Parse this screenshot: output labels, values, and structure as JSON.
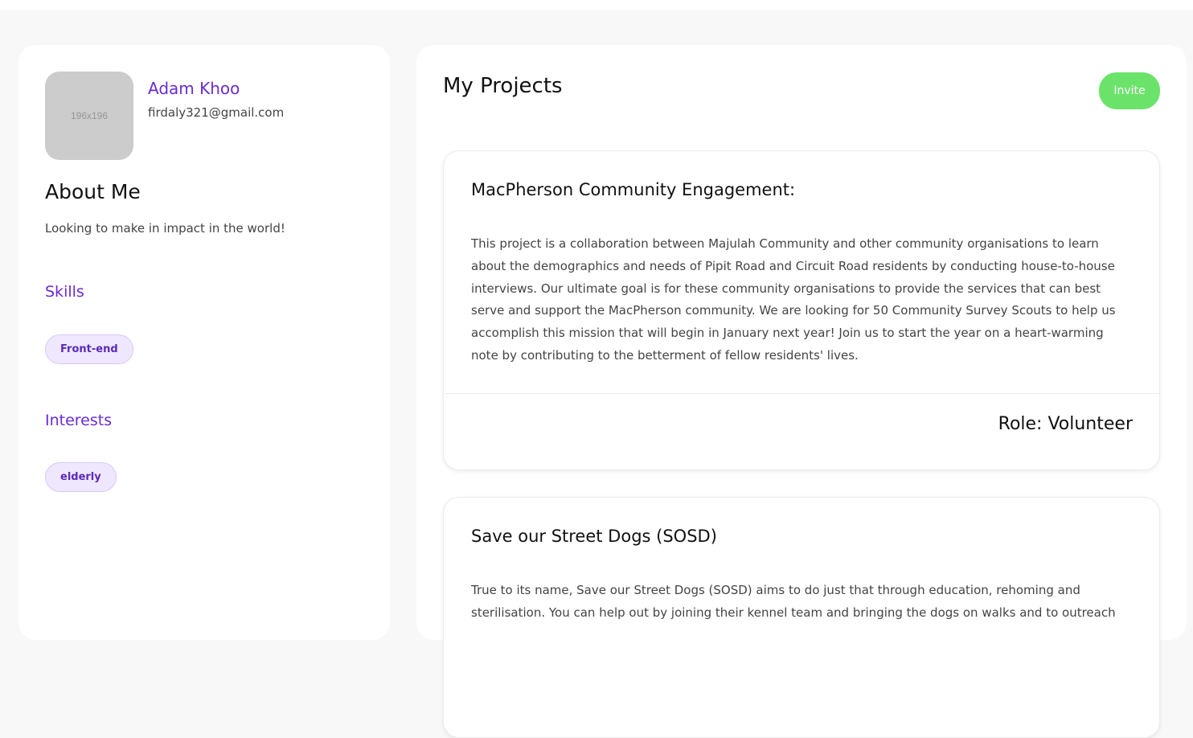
{
  "profile": {
    "avatar_placeholder": "196x196",
    "name": "Adam Khoo",
    "email": "firdaly321@gmail.com",
    "about_title": "About Me",
    "about_text": "Looking to make in impact in the world!",
    "skills_title": "Skills",
    "skills": [
      "Front-end"
    ],
    "interests_title": "Interests",
    "interests": [
      "elderly"
    ]
  },
  "projects": {
    "title": "My Projects",
    "invite_label": "Invite",
    "items": [
      {
        "title": "MacPherson Community Engagement:",
        "description": "This project is a collaboration between Majulah Community and other community organisations to learn about the demographics and needs of Pipit Road and Circuit Road residents by conducting house-to-house interviews. Our ultimate goal is for these community organisations to provide the services that can best serve and support the MacPherson community. We are looking for 50 Community Survey Scouts to help us accomplish this mission that will begin in January next year! Join us to start the year on a heart-warming note by contributing to the betterment of fellow residents' lives.",
        "role": "Role: Volunteer"
      },
      {
        "title": "Save our Street Dogs (SOSD)",
        "description": "True to its name, Save our Street Dogs (SOSD) aims to do just that through education, rehoming and sterilisation. You can help out by joining their kennel team and bringing the dogs on walks and to outreach"
      }
    ]
  },
  "colors": {
    "accent": "#6a2bd3",
    "invite": "#6be36b",
    "tag_bg": "#efe7fd",
    "page_bg": "#f8f8f8"
  }
}
